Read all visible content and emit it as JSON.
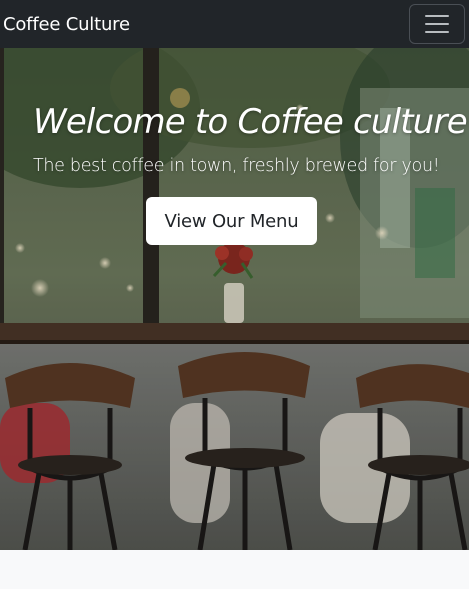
{
  "navbar": {
    "brand": "Coffee Culture",
    "toggle_icon": "hamburger-menu-icon"
  },
  "hero": {
    "title": "Welcome to Coffee culture",
    "subtitle": "The best coffee in town, freshly brewed for you!",
    "cta_label": "View Our Menu",
    "background_image": "coffee-shop-window-photo"
  },
  "colors": {
    "navbar_bg": "#212529",
    "page_bg": "#f8f9fa",
    "button_bg": "#ffffff",
    "text_light": "#ffffff"
  }
}
